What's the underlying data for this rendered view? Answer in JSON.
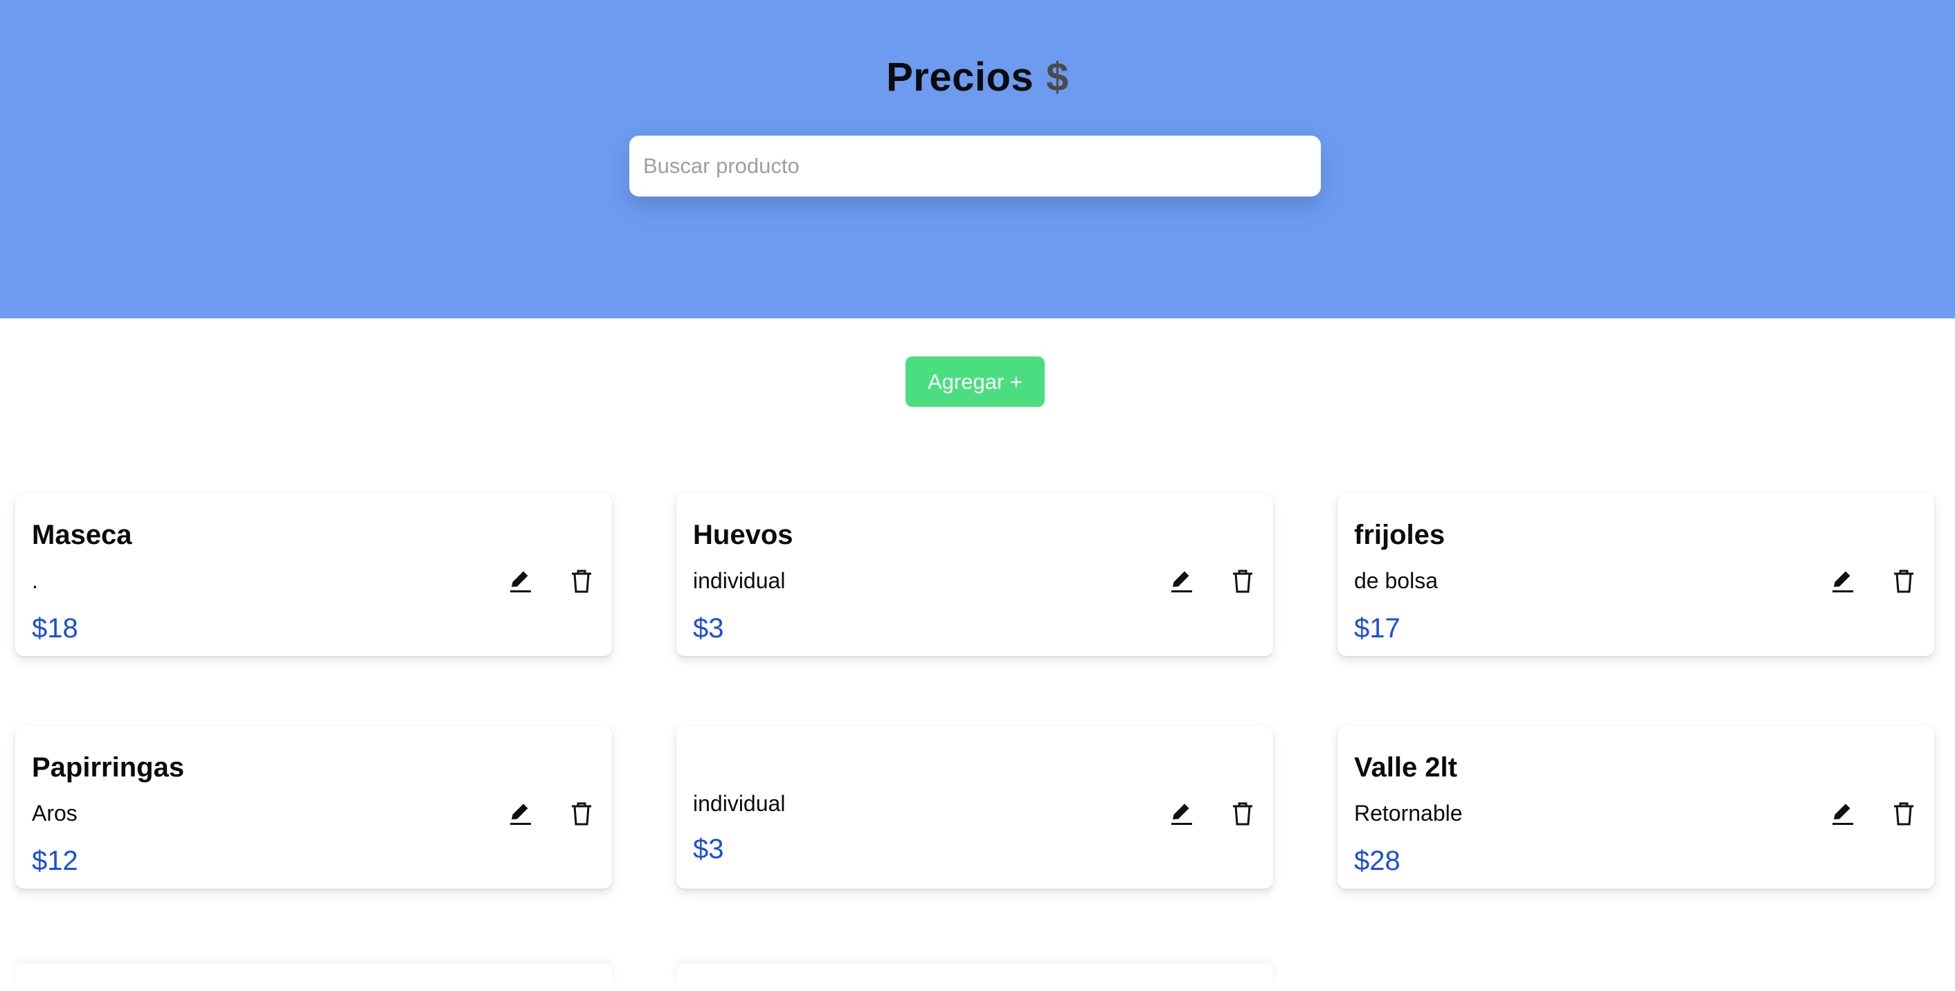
{
  "header": {
    "title": "Precios",
    "currency_symbol": "$",
    "background_color": "#6c9bf0"
  },
  "search": {
    "placeholder": "Buscar producto",
    "value": ""
  },
  "actions": {
    "add_label": "Agregar +",
    "add_color": "#4ade80"
  },
  "products": [
    {
      "name": "Maseca",
      "description": ".",
      "price": "$18"
    },
    {
      "name": "Huevos",
      "description": "individual",
      "price": "$3"
    },
    {
      "name": "frijoles",
      "description": "de bolsa",
      "price": "$17"
    },
    {
      "name": "Papirringas",
      "description": "Aros",
      "price": "$12"
    },
    {
      "name": "",
      "description": "individual",
      "price": "$3"
    },
    {
      "name": "Valle 2lt",
      "description": "Retornable",
      "price": "$28"
    }
  ],
  "icons": {
    "edit": "pencil-icon",
    "delete": "trash-icon"
  },
  "price_color": "#1d4ed8"
}
